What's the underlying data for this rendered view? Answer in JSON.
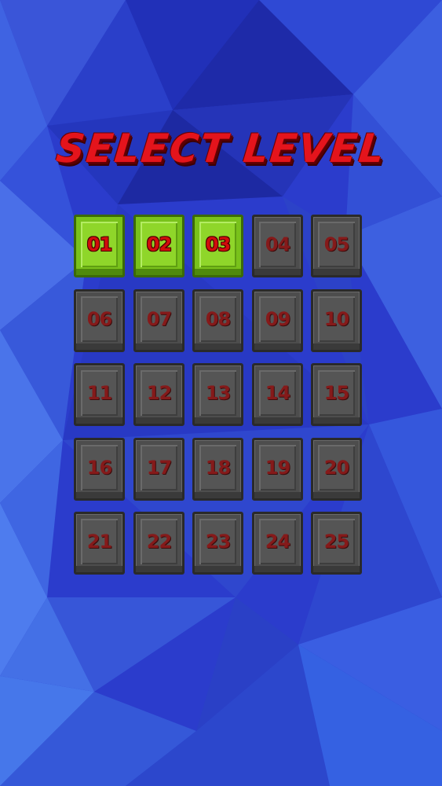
{
  "screen": {
    "title": "SELECT LEVEL"
  },
  "colors": {
    "background_base": "#2c3fcf",
    "title_red": "#e4141c",
    "unlocked_green": "#8fd62a",
    "locked_gray": "#555555",
    "number_red": "#d10c0c"
  },
  "levels": [
    {
      "label": "01",
      "state": "unlocked"
    },
    {
      "label": "02",
      "state": "unlocked"
    },
    {
      "label": "03",
      "state": "unlocked"
    },
    {
      "label": "04",
      "state": "locked"
    },
    {
      "label": "05",
      "state": "locked"
    },
    {
      "label": "06",
      "state": "locked"
    },
    {
      "label": "07",
      "state": "locked"
    },
    {
      "label": "08",
      "state": "locked"
    },
    {
      "label": "09",
      "state": "locked"
    },
    {
      "label": "10",
      "state": "locked"
    },
    {
      "label": "11",
      "state": "locked"
    },
    {
      "label": "12",
      "state": "locked"
    },
    {
      "label": "13",
      "state": "locked"
    },
    {
      "label": "14",
      "state": "locked"
    },
    {
      "label": "15",
      "state": "locked"
    },
    {
      "label": "16",
      "state": "locked"
    },
    {
      "label": "17",
      "state": "locked"
    },
    {
      "label": "18",
      "state": "locked"
    },
    {
      "label": "19",
      "state": "locked"
    },
    {
      "label": "20",
      "state": "locked"
    },
    {
      "label": "21",
      "state": "locked"
    },
    {
      "label": "22",
      "state": "locked"
    },
    {
      "label": "23",
      "state": "locked"
    },
    {
      "label": "24",
      "state": "locked"
    },
    {
      "label": "25",
      "state": "locked"
    }
  ]
}
